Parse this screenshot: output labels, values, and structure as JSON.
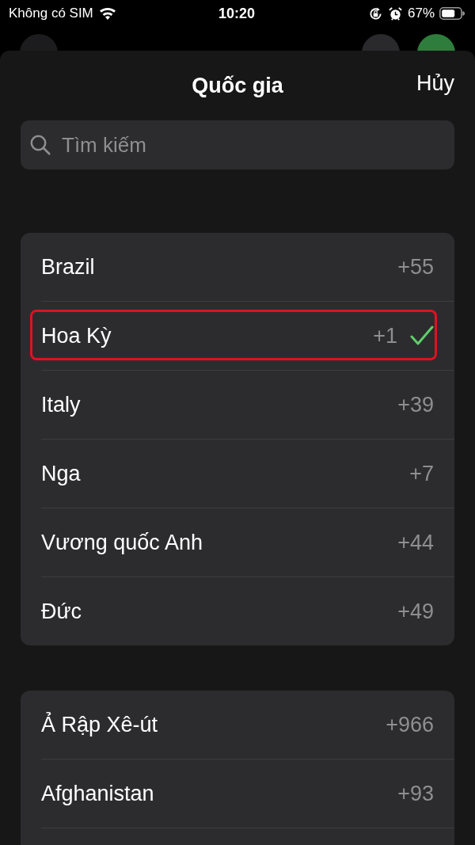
{
  "status_bar": {
    "carrier": "Không có SIM",
    "time": "10:20",
    "battery": "67%"
  },
  "sheet": {
    "title": "Quốc gia",
    "cancel": "Hủy",
    "search": {
      "placeholder": "Tìm kiếm"
    }
  },
  "sections": [
    {
      "rows": [
        {
          "name": "Brazil",
          "code": "+55",
          "selected": false,
          "highlighted": false
        },
        {
          "name": "Hoa Kỳ",
          "code": "+1",
          "selected": true,
          "highlighted": true
        },
        {
          "name": "Italy",
          "code": "+39",
          "selected": false,
          "highlighted": false
        },
        {
          "name": "Nga",
          "code": "+7",
          "selected": false,
          "highlighted": false
        },
        {
          "name": "Vương quốc Anh",
          "code": "+44",
          "selected": false,
          "highlighted": false
        },
        {
          "name": "Đức",
          "code": "+49",
          "selected": false,
          "highlighted": false
        }
      ]
    },
    {
      "rows": [
        {
          "name": "Ả Rập Xê-út",
          "code": "+966",
          "selected": false,
          "highlighted": false
        },
        {
          "name": "Afghanistan",
          "code": "+93",
          "selected": false,
          "highlighted": false
        }
      ]
    }
  ]
}
